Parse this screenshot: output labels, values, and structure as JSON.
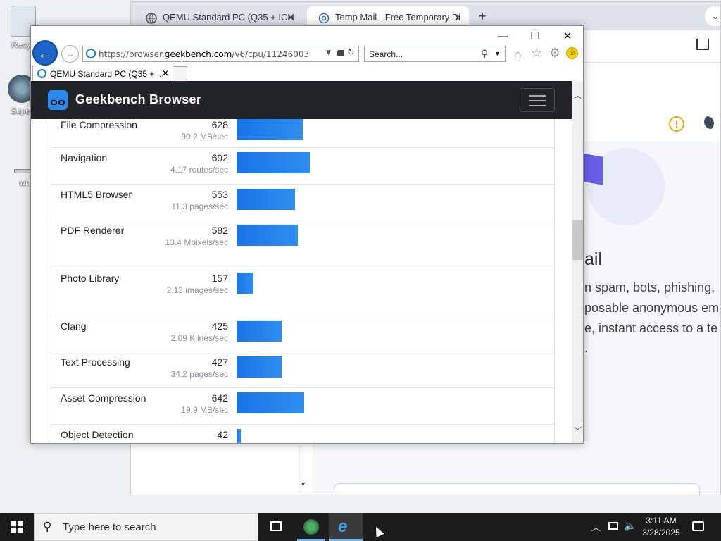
{
  "desktop": {
    "icons": [
      {
        "label": "Recyc"
      },
      {
        "label": "Super"
      },
      {
        "label": "wh"
      }
    ]
  },
  "chrome": {
    "tabs": [
      {
        "label": "QEMU Standard PC (Q35 + ICH"
      },
      {
        "label": "Temp Mail - Free Temporary Di"
      }
    ],
    "mail_heading_fragment": "ail",
    "mail_lines": [
      "n spam, bots, phishing,",
      "posable anonymous em",
      "e, instant access to a te",
      "."
    ]
  },
  "ie": {
    "address": {
      "prefix": "https://browser.",
      "domain": "geekbench.com",
      "suffix": "/v6/cpu/11246003"
    },
    "search_placeholder": "Search...",
    "tab_label": "QEMU Standard PC (Q35 + ...",
    "controls": {
      "minimize": "—",
      "maximize": "☐",
      "close": "✕"
    }
  },
  "page": {
    "brand": "Geekbench Browser",
    "max_score": 692,
    "rows": [
      {
        "name": "File Compression",
        "score": "628",
        "unit": "90.2 MB/sec",
        "value": 628
      },
      {
        "name": "Navigation",
        "score": "692",
        "unit": "4.17 routes/sec",
        "value": 692
      },
      {
        "name": "HTML5 Browser",
        "score": "553",
        "unit": "11.3 pages/sec",
        "value": 553
      },
      {
        "name": "PDF Renderer",
        "score": "582",
        "unit": "13.4 Mpixels/sec",
        "value": 582
      },
      {
        "name": "Photo Library",
        "score": "157",
        "unit": "2.13 images/sec",
        "value": 157
      },
      {
        "name": "Clang",
        "score": "425",
        "unit": "2.09 Klines/sec",
        "value": 425
      },
      {
        "name": "Text Processing",
        "score": "427",
        "unit": "34.2 pages/sec",
        "value": 427
      },
      {
        "name": "Asset Compression",
        "score": "642",
        "unit": "19.9 MB/sec",
        "value": 642
      },
      {
        "name": "Object Detection",
        "score": "42",
        "unit": "",
        "value": 42
      }
    ]
  },
  "taskbar": {
    "search_placeholder": "Type here to search",
    "time": "3:11 AM",
    "date": "3/28/2025"
  },
  "colors": {
    "bar": "#1a73e8",
    "navbar": "#212529",
    "taskbar": "#1c1c1c"
  }
}
